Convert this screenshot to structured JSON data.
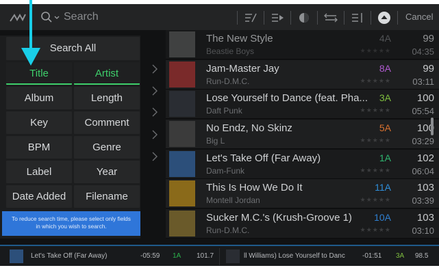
{
  "toolbar": {
    "search_placeholder": "Search",
    "cancel_label": "Cancel"
  },
  "panel": {
    "search_all_label": "Search All",
    "fields": [
      {
        "label": "Title",
        "selected": true
      },
      {
        "label": "Artist",
        "selected": true
      },
      {
        "label": "Album",
        "selected": false
      },
      {
        "label": "Length",
        "selected": false
      },
      {
        "label": "Key",
        "selected": false
      },
      {
        "label": "Comment",
        "selected": false
      },
      {
        "label": "BPM",
        "selected": false
      },
      {
        "label": "Genre",
        "selected": false
      },
      {
        "label": "Label",
        "selected": false
      },
      {
        "label": "Year",
        "selected": false
      },
      {
        "label": "Date Added",
        "selected": false
      },
      {
        "label": "Filename",
        "selected": false
      }
    ],
    "tip_line1": "To reduce search time, please select only fields",
    "tip_line2": "in which you wish to search."
  },
  "tracks": [
    {
      "title": "The New Style",
      "artist": "Beastie Boys",
      "key": "4A",
      "key_color": "#6c6e71",
      "bpm": "99",
      "length": "04:35",
      "art": "#555",
      "dim": true
    },
    {
      "title": "Jam-Master Jay",
      "artist": "Run-D.M.C.",
      "key": "8A",
      "key_color": "#b05ad0",
      "bpm": "99",
      "length": "03:11",
      "art": "#7a2a2a",
      "dim": false
    },
    {
      "title": "Lose Yourself to Dance (feat. Pha...",
      "artist": "Daft Punk",
      "key": "3A",
      "key_color": "#7fbf3f",
      "bpm": "100",
      "length": "05:54",
      "art": "#2a2d33",
      "dim": false
    },
    {
      "title": "No Endz, No Skinz",
      "artist": "Big L",
      "key": "5A",
      "key_color": "#d9712f",
      "bpm": "100",
      "length": "03:29",
      "art": "#3b3b3b",
      "dim": false
    },
    {
      "title": "Let's Take Off (Far Away)",
      "artist": "Dam-Funk",
      "key": "1A",
      "key_color": "#2fb56f",
      "bpm": "102",
      "length": "06:04",
      "art": "#2c4f7a",
      "dim": false
    },
    {
      "title": "This Is How We Do It",
      "artist": "Montell Jordan",
      "key": "11A",
      "key_color": "#2f8ed9",
      "bpm": "103",
      "length": "03:39",
      "art": "#8a6a1a",
      "dim": false
    },
    {
      "title": "Sucker M.C.'s (Krush-Groove 1)",
      "artist": "Run-D.M.C.",
      "key": "10A",
      "key_color": "#2f7fd0",
      "bpm": "103",
      "length": "03:10",
      "art": "#6a5a2a",
      "dim": false
    }
  ],
  "stars": "★★★★★",
  "deck_left": {
    "title": "Let's Take Off (Far Away)",
    "time": "-05:59",
    "key": "1A",
    "bpm": "101.7"
  },
  "deck_right": {
    "title": "ll Williams)   Lose Yourself to Danc",
    "time": "-01:51",
    "key": "3A",
    "bpm": "98.5"
  },
  "colors": {
    "accent_green": "#3ecf6b",
    "tip_blue": "#2f76d9",
    "arrow_cyan": "#19cfe9"
  }
}
